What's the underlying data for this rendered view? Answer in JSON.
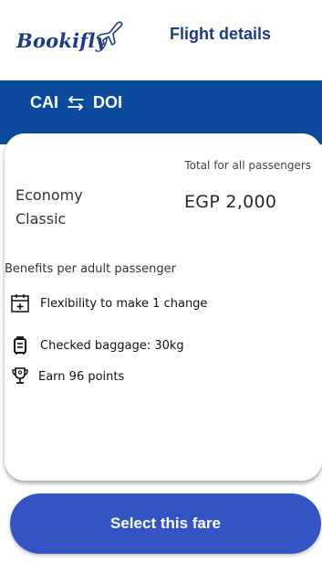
{
  "brand": {
    "name": "Bookifly",
    "color": "#1f3a8a"
  },
  "header": {
    "title": "Flight details"
  },
  "route": {
    "origin": "CAI",
    "destination": "DOI",
    "icon": "swap-arrows-icon"
  },
  "colors": {
    "route_bar": "#0b4a9c",
    "primary_button": "#3454c4"
  },
  "fare": {
    "total_label": "Total for all passengers",
    "name": "Economy Classic",
    "price": "EGP 2,000"
  },
  "benefits": {
    "title": "Benefits per adult passenger",
    "items": [
      {
        "icon": "calendar-plus-icon",
        "label": "Flexibility to make 1 change"
      },
      {
        "icon": "luggage-icon",
        "label": "Checked baggage: 30kg"
      },
      {
        "icon": "trophy-icon",
        "label": "Earn  96 points"
      }
    ]
  },
  "actions": {
    "select_label": "Select this fare"
  }
}
